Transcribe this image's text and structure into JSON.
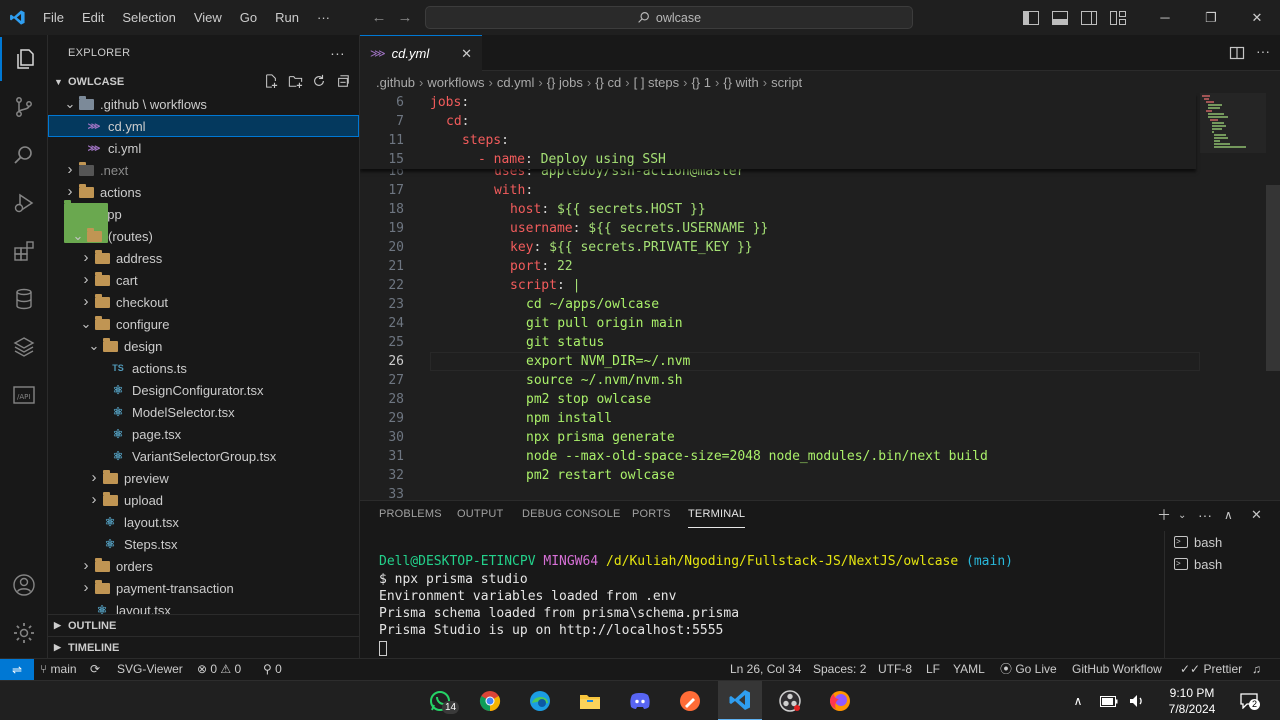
{
  "titlebar": {
    "menu": [
      "File",
      "Edit",
      "Selection",
      "View",
      "Go",
      "Run",
      "···"
    ],
    "search_text": "owlcase"
  },
  "sidebar": {
    "header": "EXPLORER",
    "more": "···",
    "root_section": "OWLCASE",
    "tree": [
      {
        "label": ".github \\ workflows",
        "depth": 0,
        "type": "folder",
        "open": true,
        "kind": "gh"
      },
      {
        "label": "cd.yml",
        "depth": 1,
        "type": "yml",
        "selected": true
      },
      {
        "label": "ci.yml",
        "depth": 1,
        "type": "yml"
      },
      {
        "label": ".next",
        "depth": 0,
        "type": "folder",
        "open": false,
        "kind": "next",
        "dim": true
      },
      {
        "label": "actions",
        "depth": 0,
        "type": "folder",
        "open": false
      },
      {
        "label": "app",
        "depth": 0,
        "type": "folder",
        "open": true,
        "kind": "app"
      },
      {
        "label": "(routes)",
        "depth": 1,
        "type": "folder",
        "open": true
      },
      {
        "label": "address",
        "depth": 2,
        "type": "folder",
        "open": false
      },
      {
        "label": "cart",
        "depth": 2,
        "type": "folder",
        "open": false
      },
      {
        "label": "checkout",
        "depth": 2,
        "type": "folder",
        "open": false
      },
      {
        "label": "configure",
        "depth": 2,
        "type": "folder",
        "open": true
      },
      {
        "label": "design",
        "depth": 3,
        "type": "folder",
        "open": true
      },
      {
        "label": "actions.ts",
        "depth": 4,
        "type": "ts"
      },
      {
        "label": "DesignConfigurator.tsx",
        "depth": 4,
        "type": "tsx"
      },
      {
        "label": "ModelSelector.tsx",
        "depth": 4,
        "type": "tsx"
      },
      {
        "label": "page.tsx",
        "depth": 4,
        "type": "tsx"
      },
      {
        "label": "VariantSelectorGroup.tsx",
        "depth": 4,
        "type": "tsx"
      },
      {
        "label": "preview",
        "depth": 3,
        "type": "folder",
        "open": false
      },
      {
        "label": "upload",
        "depth": 3,
        "type": "folder",
        "open": false
      },
      {
        "label": "layout.tsx",
        "depth": 3,
        "type": "tsx"
      },
      {
        "label": "Steps.tsx",
        "depth": 3,
        "type": "tsx"
      },
      {
        "label": "orders",
        "depth": 2,
        "type": "folder",
        "open": false
      },
      {
        "label": "payment-transaction",
        "depth": 2,
        "type": "folder",
        "open": false
      },
      {
        "label": "layout.tsx",
        "depth": 2,
        "type": "tsx"
      }
    ],
    "outline": "OUTLINE",
    "timeline": "TIMELINE"
  },
  "editor": {
    "tab_label": "cd.yml",
    "breadcrumb": [
      ".github",
      "workflows",
      "cd.yml",
      "{} jobs",
      "{} cd",
      "[ ] steps",
      "{} 1",
      "{} with",
      "script"
    ],
    "sticky_lines": [
      {
        "num": "6",
        "indent": 0,
        "key": "jobs",
        "val": ""
      },
      {
        "num": "7",
        "indent": 2,
        "key": "cd",
        "val": ""
      },
      {
        "num": "11",
        "indent": 4,
        "key": "steps",
        "val": ""
      },
      {
        "num": "15",
        "indent": 6,
        "key": "- name",
        "val": " Deploy using SSH"
      }
    ],
    "lines": [
      {
        "num": "16",
        "indent": 8,
        "key": "uses",
        "val": " appleboy/ssh-action@master"
      },
      {
        "num": "17",
        "indent": 8,
        "key": "with",
        "val": ""
      },
      {
        "num": "18",
        "indent": 10,
        "key": "host",
        "val": " ${{ secrets.HOST }}"
      },
      {
        "num": "19",
        "indent": 10,
        "key": "username",
        "val": " ${{ secrets.USERNAME }}"
      },
      {
        "num": "20",
        "indent": 10,
        "key": "key",
        "val": " ${{ secrets.PRIVATE_KEY }}"
      },
      {
        "num": "21",
        "indent": 10,
        "key": "port",
        "val": " 22"
      },
      {
        "num": "22",
        "indent": 10,
        "key": "script",
        "val": " |"
      },
      {
        "num": "23",
        "indent": 12,
        "key": "",
        "val": "cd ~/apps/owlcase"
      },
      {
        "num": "24",
        "indent": 12,
        "key": "",
        "val": "git pull origin main"
      },
      {
        "num": "25",
        "indent": 12,
        "key": "",
        "val": "git status"
      },
      {
        "num": "26",
        "indent": 12,
        "key": "",
        "val": "export NVM_DIR=~/.nvm",
        "current": true
      },
      {
        "num": "27",
        "indent": 12,
        "key": "",
        "val": "source ~/.nvm/nvm.sh"
      },
      {
        "num": "28",
        "indent": 12,
        "key": "",
        "val": "pm2 stop owlcase"
      },
      {
        "num": "29",
        "indent": 12,
        "key": "",
        "val": "npm install"
      },
      {
        "num": "30",
        "indent": 12,
        "key": "",
        "val": "npx prisma generate"
      },
      {
        "num": "31",
        "indent": 12,
        "key": "",
        "val": "node --max-old-space-size=2048 node_modules/.bin/next build"
      },
      {
        "num": "32",
        "indent": 12,
        "key": "",
        "val": "pm2 restart owlcase"
      },
      {
        "num": "33",
        "indent": 0,
        "key": "",
        "val": ""
      }
    ]
  },
  "panel": {
    "tabs": [
      "PROBLEMS",
      "OUTPUT",
      "DEBUG CONSOLE",
      "PORTS",
      "TERMINAL"
    ],
    "active_tab": "TERMINAL",
    "terminal": {
      "prompt_user": "Dell@DESKTOP-ETINCPV",
      "prompt_shell": "MINGW64",
      "prompt_path": "/d/Kuliah/Ngoding/Fullstack-JS/NextJS/owlcase",
      "prompt_branch": "(main)",
      "command": "$ npx prisma studio",
      "output": [
        "Environment variables loaded from .env",
        "Prisma schema loaded from prisma\\schema.prisma",
        "Prisma Studio is up on http://localhost:5555"
      ]
    },
    "terminals": [
      "bash",
      "bash"
    ]
  },
  "statusbar": {
    "branch": "main",
    "svg_viewer": "SVG-Viewer",
    "errors": "0",
    "warnings": "0",
    "ports": "0",
    "position": "Ln 26, Col 34",
    "spaces": "Spaces: 2",
    "encoding": "UTF-8",
    "eol": "LF",
    "language": "YAML",
    "go_live": "Go Live",
    "github_workflow": "GitHub Workflow",
    "prettier": "Prettier"
  },
  "taskbar": {
    "whatsapp_badge": "14",
    "time": "9:10 PM",
    "date": "7/8/2024",
    "notif_count": "2"
  },
  "colors": {
    "accent": "#0078d4",
    "yaml_key": "#f25c5c",
    "yaml_value": "#a5e075"
  }
}
